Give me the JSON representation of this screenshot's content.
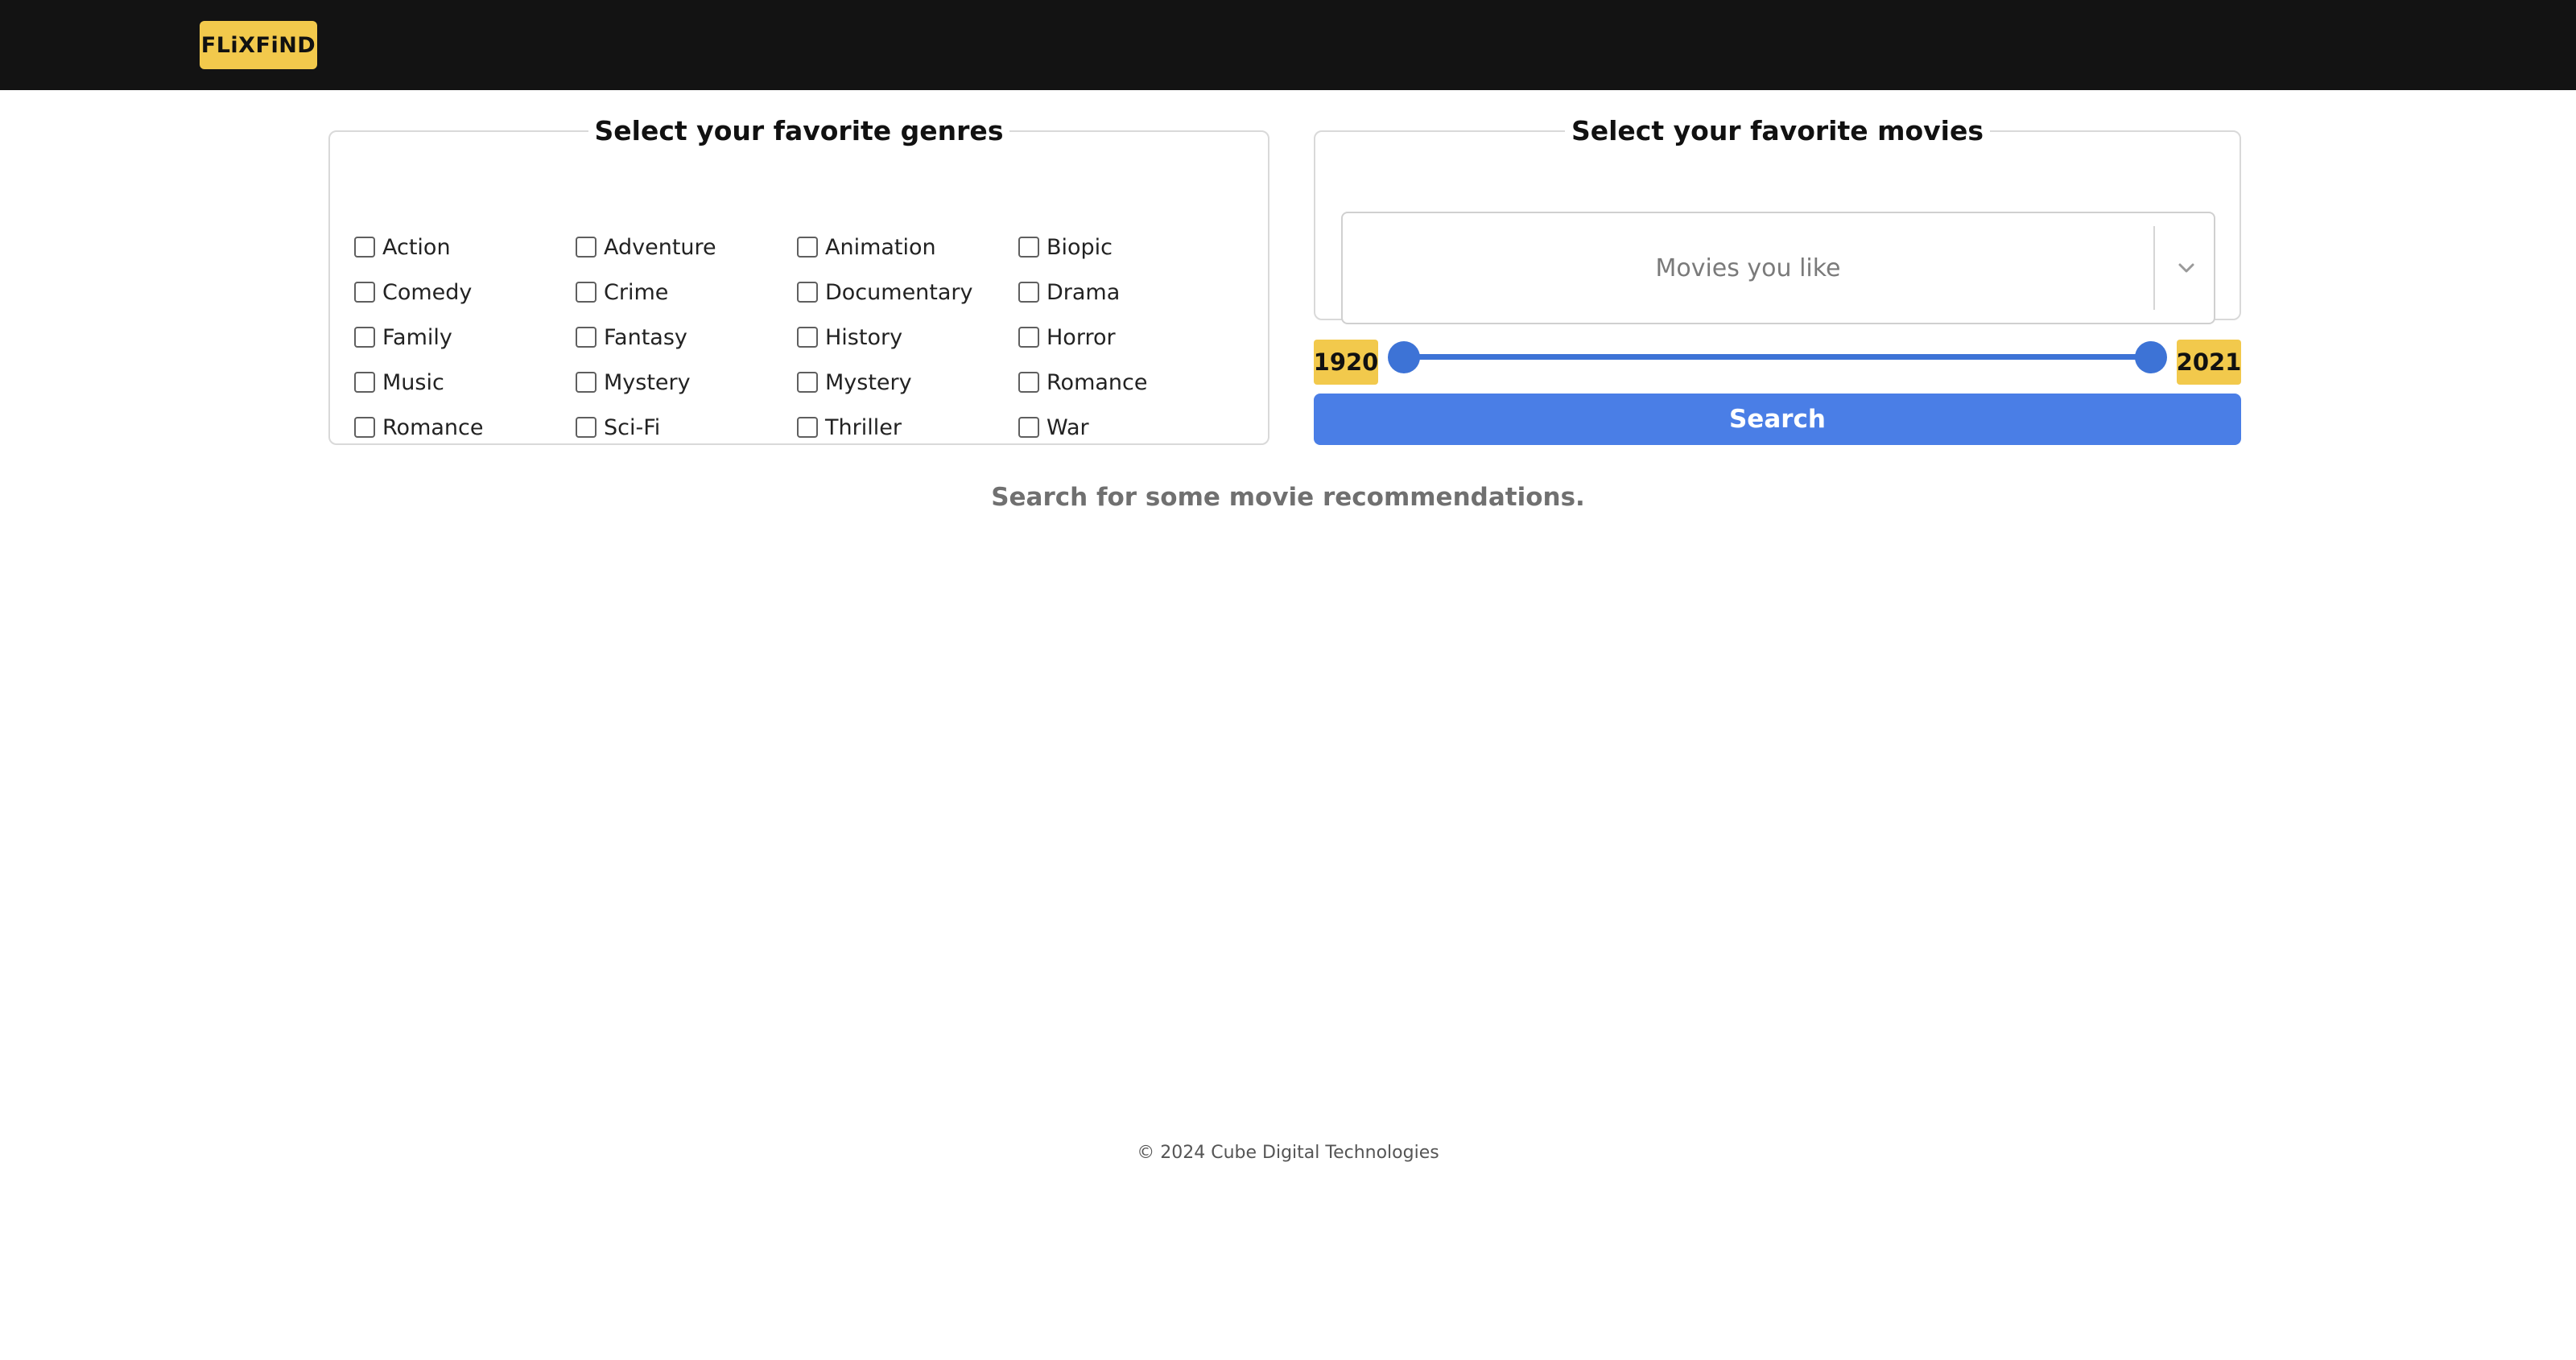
{
  "header": {
    "logo_text": "FLiXFiND",
    "background_color": "#131313",
    "logo_color": "#f2c94c"
  },
  "genres": {
    "title": "Select your favorite genres",
    "items": [
      {
        "label": "Action",
        "checked": false
      },
      {
        "label": "Adventure",
        "checked": false
      },
      {
        "label": "Animation",
        "checked": false
      },
      {
        "label": "Biopic",
        "checked": false
      },
      {
        "label": "Comedy",
        "checked": false
      },
      {
        "label": "Crime",
        "checked": false
      },
      {
        "label": "Documentary",
        "checked": false
      },
      {
        "label": "Drama",
        "checked": false
      },
      {
        "label": "Family",
        "checked": false
      },
      {
        "label": "Fantasy",
        "checked": false
      },
      {
        "label": "History",
        "checked": false
      },
      {
        "label": "Horror",
        "checked": false
      },
      {
        "label": "Music",
        "checked": false
      },
      {
        "label": "Mystery",
        "checked": false
      },
      {
        "label": "Mystery",
        "checked": false
      },
      {
        "label": "Romance",
        "checked": false
      },
      {
        "label": "Romance",
        "checked": false
      },
      {
        "label": "Sci-Fi",
        "checked": false
      },
      {
        "label": "Thriller",
        "checked": false
      },
      {
        "label": "War",
        "checked": false
      }
    ]
  },
  "movies": {
    "title": "Select your favorite movies",
    "placeholder": "Movies you like",
    "dropdown_icon": "chevron-down-icon"
  },
  "year_range": {
    "min_label": "1920",
    "max_label": "2021",
    "slider_color": "#3d73d6",
    "badge_color": "#f2c94c"
  },
  "search": {
    "button_label": "Search",
    "button_color": "#4a7ee6",
    "hint": "Search for some movie recommendations."
  },
  "footer": {
    "copyright": "© 2024 Cube Digital Technologies"
  }
}
